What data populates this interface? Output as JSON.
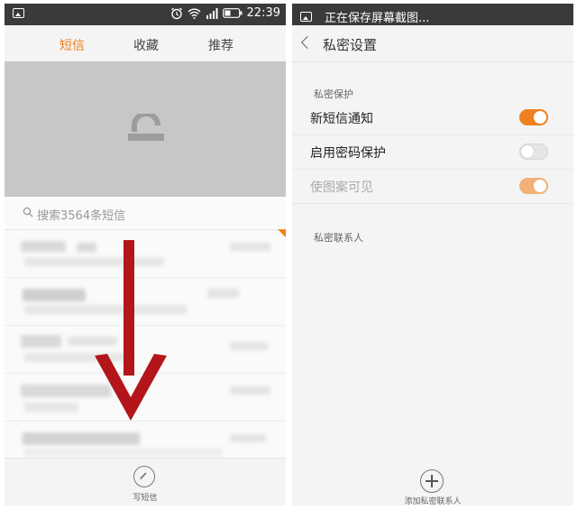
{
  "left_phone": {
    "status_bar": {
      "time": "22:39"
    },
    "tabs": [
      {
        "label": "短信",
        "active": true
      },
      {
        "label": "收藏",
        "active": false
      },
      {
        "label": "推荐",
        "active": false
      }
    ],
    "search": {
      "placeholder": "搜索3564条短信"
    },
    "bottom": {
      "compose_label": "写短信"
    }
  },
  "right_phone": {
    "status_bar": {
      "text": "正在保存屏幕截图..."
    },
    "header": {
      "title": "私密设置"
    },
    "sections": {
      "protection": "私密保护",
      "contacts": "私密联系人"
    },
    "settings": [
      {
        "label": "新短信通知",
        "enabled": true,
        "disabled_state": false
      },
      {
        "label": "启用密码保护",
        "enabled": false,
        "disabled_state": false
      },
      {
        "label": "使图案可见",
        "enabled": true,
        "disabled_state": true
      }
    ],
    "bottom": {
      "add_label": "添加私密联系人"
    }
  },
  "colors": {
    "accent": "#f0801f",
    "arrow": "#b3151b",
    "status_bar": "#3a3a3a"
  }
}
